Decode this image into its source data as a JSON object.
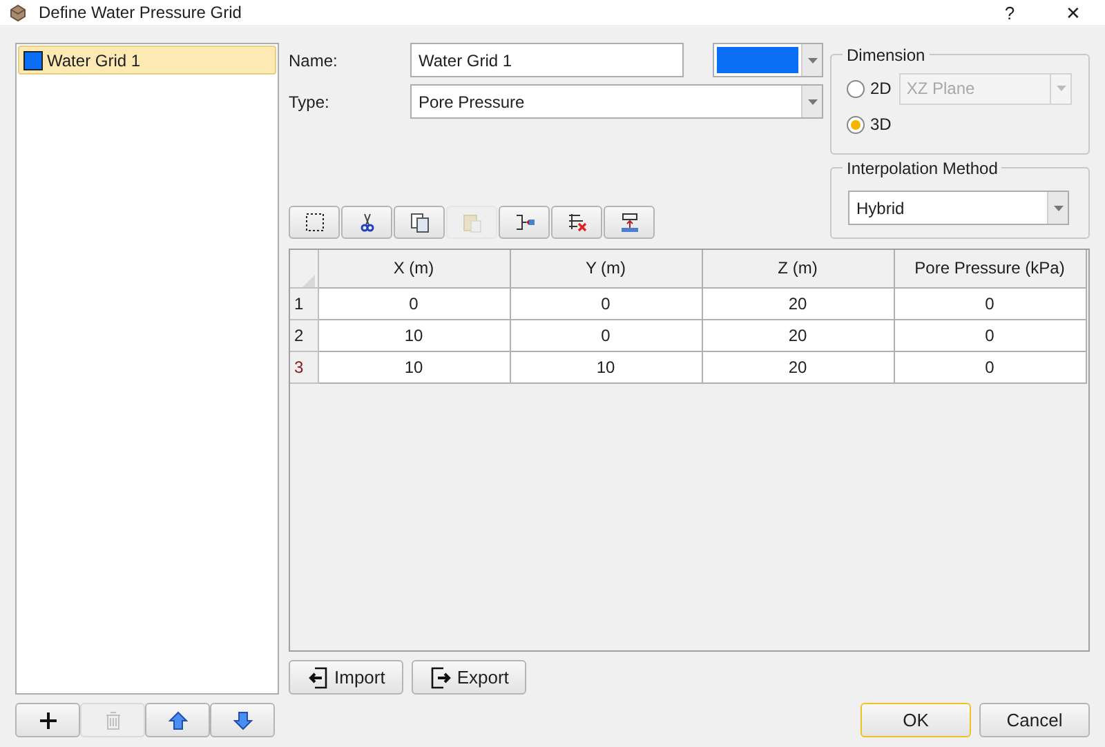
{
  "window": {
    "title": "Define Water Pressure Grid",
    "help": "?",
    "close": "✕"
  },
  "grids": [
    {
      "label": "Water Grid 1",
      "color": "#0a6ff5",
      "selected": true
    }
  ],
  "list_buttons": [
    {
      "kind": "add",
      "disabled": false
    },
    {
      "kind": "delete",
      "disabled": true
    },
    {
      "kind": "up",
      "disabled": false
    },
    {
      "kind": "down",
      "disabled": false
    }
  ],
  "name": {
    "label": "Name:",
    "value": "Water Grid 1",
    "color": "#0a6ff5"
  },
  "type": {
    "label": "Type:",
    "value": "Pore Pressure"
  },
  "dimension": {
    "title": "Dimension",
    "options": [
      {
        "label": "2D",
        "selected": false
      },
      {
        "label": "3D",
        "selected": true
      }
    ],
    "plane": {
      "value": "XZ Plane",
      "disabled": true
    }
  },
  "interpolation": {
    "title": "Interpolation Method",
    "value": "Hybrid"
  },
  "toolbar": [
    {
      "kind": "select",
      "disabled": false
    },
    {
      "kind": "cut",
      "disabled": false
    },
    {
      "kind": "copy",
      "disabled": false
    },
    {
      "kind": "paste",
      "disabled": true
    },
    {
      "kind": "insert",
      "disabled": false
    },
    {
      "kind": "remove",
      "disabled": false
    },
    {
      "kind": "append",
      "disabled": false
    }
  ],
  "table": {
    "columns": [
      "X (m)",
      "Y (m)",
      "Z (m)",
      "Pore Pressure (kPa)"
    ],
    "rows": [
      {
        "number": "1",
        "selected": false,
        "cells": [
          "0",
          "0",
          "20",
          "0"
        ]
      },
      {
        "number": "2",
        "selected": false,
        "cells": [
          "10",
          "0",
          "20",
          "0"
        ]
      },
      {
        "number": "3",
        "selected": true,
        "cells": [
          "10",
          "10",
          "20",
          "0"
        ]
      }
    ]
  },
  "io_buttons": [
    {
      "kind": "import",
      "label": "Import"
    },
    {
      "kind": "export",
      "label": "Export"
    }
  ],
  "dialog_buttons": [
    {
      "label": "OK",
      "default": true
    },
    {
      "label": "Cancel",
      "default": false
    }
  ]
}
